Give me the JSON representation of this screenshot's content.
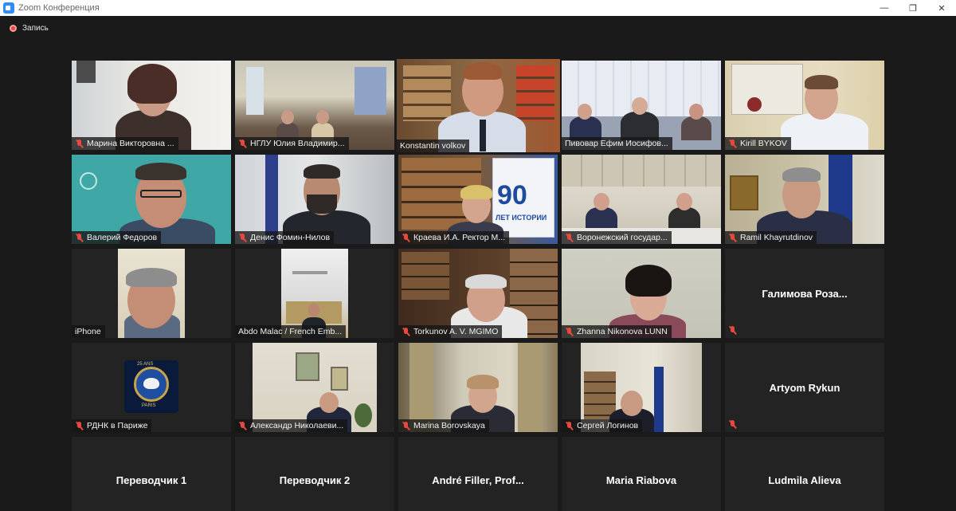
{
  "window": {
    "title": "Zoom Конференция",
    "minimize": "—",
    "restore": "❐",
    "close": "✕"
  },
  "recording": {
    "label": "Запись"
  },
  "participants": [
    {
      "name": "Марина Викторовна ...",
      "muted": true
    },
    {
      "name": "НГЛУ Юлия Владимир...",
      "muted": true
    },
    {
      "name": "Konstantin volkov",
      "muted": false
    },
    {
      "name": "Пивовар Ефим Иосифов...",
      "muted": false
    },
    {
      "name": "Kirill BYKOV",
      "muted": true
    },
    {
      "name": "Валерий Федоров",
      "muted": true
    },
    {
      "name": "Денис Фомин-Нилов",
      "muted": true
    },
    {
      "name": "Краева И.А. Ректор М...",
      "muted": true
    },
    {
      "name": "Воронежский государ...",
      "muted": true
    },
    {
      "name": "Ramil Khayrutdinov",
      "muted": true
    },
    {
      "name": "iPhone",
      "muted": false
    },
    {
      "name": "Abdo Malac / French Emb...",
      "muted": false
    },
    {
      "name": "Torkunov A. V. MGIMO",
      "muted": true
    },
    {
      "name": "Zhanna Nikonova LUNN",
      "muted": true
    },
    {
      "name": "Галимова Роза...",
      "muted": true
    },
    {
      "name": "РДНК в Париже",
      "muted": true
    },
    {
      "name": "Александр Николаеви...",
      "muted": true
    },
    {
      "name": "Marina Borovskaya",
      "muted": true
    },
    {
      "name": "Сергей Логинов",
      "muted": true
    },
    {
      "name": "Artyom Rykun",
      "muted": true
    },
    {
      "name": "Переводчик 1",
      "muted": false
    },
    {
      "name": "Переводчик 2",
      "muted": false
    },
    {
      "name": "André Filler, Prof...",
      "muted": false
    },
    {
      "name": "Maria Riabova",
      "muted": false
    },
    {
      "name": "Ludmila Alieva",
      "muted": false
    }
  ],
  "poster": {
    "big": "90",
    "line": "ЛЕТ ИСТОРИИ"
  },
  "logo": {
    "top": "25 ANS",
    "bottom": "PARIS"
  }
}
